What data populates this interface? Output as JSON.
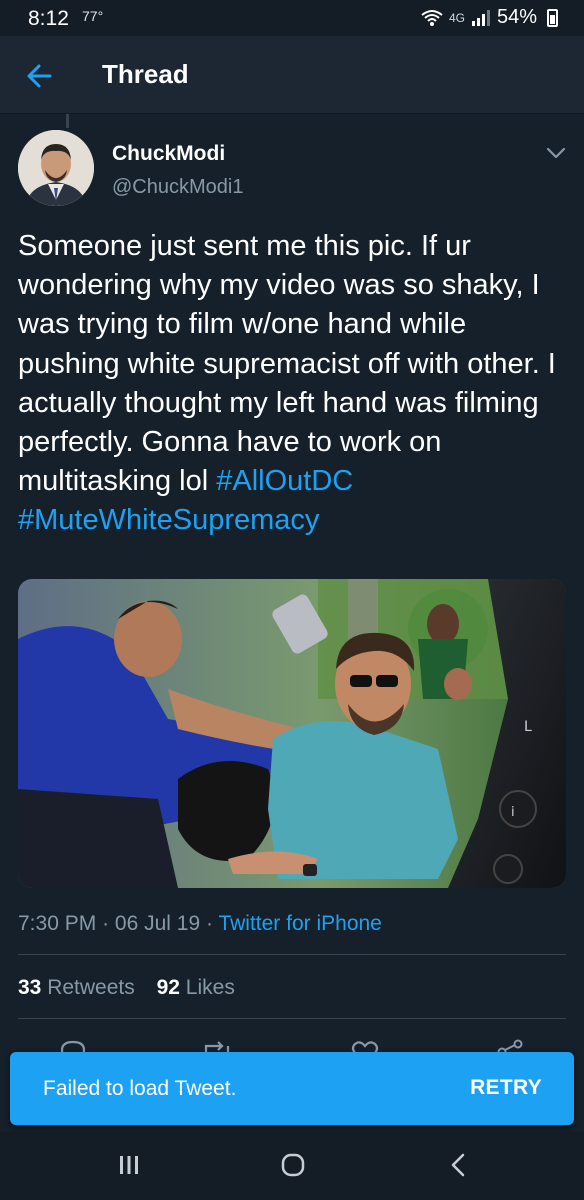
{
  "status_bar": {
    "time": "8:12",
    "temperature": "77°",
    "network": "4G",
    "battery": "54%"
  },
  "header": {
    "title": "Thread",
    "back_icon": "arrow-left-icon"
  },
  "tweet": {
    "display_name": "ChuckModi",
    "handle": "@ChuckModi1",
    "text": "Someone just sent me this pic. If ur wondering why my video was so shaky, I was trying to film w/one hand while pushing white supremacist off with other. I actually thought my left hand was filming perfectly. Gonna have to work on multitasking lol ",
    "hashtags": [
      "#AllOutDC",
      "#MuteWhiteSupremacy"
    ],
    "time": "7:30 PM",
    "date": "06 Jul 19",
    "separator": "·",
    "source": "Twitter for iPhone",
    "retweets_count": "33",
    "retweets_label": "Retweets",
    "likes_count": "92",
    "likes_label": "Likes"
  },
  "actions": [
    "reply-icon",
    "retweet-icon",
    "like-icon",
    "share-icon"
  ],
  "snackbar": {
    "message": "Failed to load Tweet.",
    "action_label": "RETRY"
  },
  "nav_bar": [
    "recents-icon",
    "home-icon",
    "back-icon"
  ],
  "colors": {
    "background": "#15202b",
    "header": "#1c2733",
    "accent": "#1da1f2",
    "secondary_text": "#8899a6",
    "divider": "#38444d"
  }
}
